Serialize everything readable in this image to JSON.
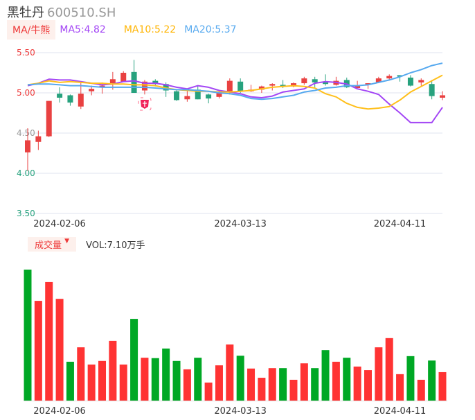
{
  "header": {
    "name": "黑牡丹",
    "code": "600510.SH"
  },
  "legend": {
    "indicator_button": "MA/牛熊",
    "ma5": "MA5:4.82",
    "ma10": "MA10:5.22",
    "ma20": "MA20:5.37"
  },
  "volume_legend": {
    "indicator_button": "成交量",
    "dropdown_icon": "▼",
    "vol": "VOL:7.10万手"
  },
  "colors": {
    "up": "#e94141",
    "down": "#27a27e",
    "vol_up": "#ff3333",
    "vol_down": "#00a825",
    "ma5": "#a346f5",
    "ma10": "#ffbf1a",
    "ma20": "#56a9ef",
    "grid": "#dfe3ef"
  },
  "chart_data": [
    {
      "type": "candlestick",
      "title": "黑牡丹 600510.SH",
      "ylim": [
        3.5,
        5.5
      ],
      "yticks": [
        {
          "label": "5.50",
          "v": 5.5,
          "color": "#ee3b3b"
        },
        {
          "label": "5.00",
          "v": 5.0,
          "color": "#ee3b3b"
        },
        {
          "label": "4.50",
          "v": 4.5,
          "color": "#999999"
        },
        {
          "label": "4.00",
          "v": 4.0,
          "color": "#27a27e"
        },
        {
          "label": "3.50",
          "v": 3.5,
          "color": "#27a27e"
        }
      ],
      "xticks": [
        {
          "label": "2024-02-06",
          "index": 3
        },
        {
          "label": "2024-03-13",
          "index": 20
        },
        {
          "label": "2024-04-11",
          "index": 35
        }
      ],
      "ohlc": [
        [
          4.26,
          4.41,
          4.56,
          4.03
        ],
        [
          4.39,
          4.46,
          4.53,
          4.29
        ],
        [
          4.46,
          4.9,
          4.9,
          4.45
        ],
        [
          4.99,
          4.94,
          5.07,
          4.88
        ],
        [
          4.97,
          4.88,
          4.98,
          4.84
        ],
        [
          4.83,
          4.99,
          5.14,
          4.8
        ],
        [
          5.02,
          5.05,
          5.09,
          4.97
        ],
        [
          5.07,
          5.09,
          5.13,
          4.99
        ],
        [
          5.12,
          5.17,
          5.26,
          5.04
        ],
        [
          5.14,
          5.25,
          5.27,
          5.14
        ],
        [
          5.26,
          5.0,
          5.41,
          5.0
        ],
        [
          5.03,
          5.14,
          5.16,
          4.98
        ],
        [
          5.15,
          5.11,
          5.17,
          5.08
        ],
        [
          5.11,
          5.03,
          5.13,
          4.95
        ],
        [
          5.02,
          4.91,
          5.03,
          4.9
        ],
        [
          4.92,
          4.96,
          5.04,
          4.89
        ],
        [
          5.04,
          4.92,
          5.09,
          4.92
        ],
        [
          4.98,
          4.93,
          4.99,
          4.87
        ],
        [
          4.95,
          5.01,
          5.03,
          4.93
        ],
        [
          5.02,
          5.15,
          5.18,
          4.98
        ],
        [
          5.14,
          5.02,
          5.18,
          5.0
        ],
        [
          5.02,
          5.04,
          5.1,
          5.01
        ],
        [
          5.04,
          5.08,
          5.09,
          5.0
        ],
        [
          5.09,
          5.11,
          5.12,
          5.03
        ],
        [
          5.1,
          5.08,
          5.16,
          5.06
        ],
        [
          5.08,
          5.12,
          5.13,
          5.07
        ],
        [
          5.12,
          5.18,
          5.2,
          5.1
        ],
        [
          5.17,
          5.13,
          5.2,
          5.07
        ],
        [
          5.13,
          5.11,
          5.23,
          5.09
        ],
        [
          5.1,
          5.15,
          5.2,
          5.09
        ],
        [
          5.16,
          5.07,
          5.19,
          5.06
        ],
        [
          5.06,
          5.09,
          5.15,
          5.06
        ],
        [
          5.1,
          5.12,
          5.12,
          5.05
        ],
        [
          5.13,
          5.18,
          5.2,
          5.12
        ],
        [
          5.18,
          5.21,
          5.23,
          5.16
        ],
        [
          5.22,
          5.21,
          5.22,
          5.14
        ],
        [
          5.19,
          5.09,
          5.22,
          5.08
        ],
        [
          5.13,
          5.16,
          5.18,
          5.09
        ],
        [
          5.11,
          4.96,
          5.16,
          4.92
        ],
        [
          4.94,
          4.97,
          5.02,
          4.91
        ]
      ],
      "series": [
        {
          "name": "MA5",
          "values": [
            5.09,
            5.12,
            5.17,
            5.16,
            5.16,
            5.14,
            5.12,
            5.1,
            5.11,
            5.14,
            5.15,
            5.12,
            5.12,
            5.1,
            5.07,
            5.05,
            5.09,
            5.07,
            5.03,
            5.01,
            4.99,
            4.95,
            4.94,
            4.96,
            5.01,
            5.03,
            5.05,
            5.12,
            5.14,
            5.13,
            5.11,
            5.05,
            5.02,
            4.98,
            4.86,
            4.75,
            4.63,
            4.63,
            4.63,
            4.82
          ]
        },
        {
          "name": "MA10",
          "values": [
            5.1,
            5.12,
            5.15,
            5.13,
            5.14,
            5.13,
            5.12,
            5.12,
            5.11,
            5.11,
            5.1,
            5.1,
            5.09,
            5.06,
            5.04,
            5.03,
            5.02,
            5.02,
            5.01,
            5.01,
            5.02,
            5.03,
            5.05,
            5.07,
            5.08,
            5.09,
            5.08,
            5.06,
            4.99,
            4.95,
            4.87,
            4.82,
            4.8,
            4.81,
            4.83,
            4.91,
            5.01,
            5.08,
            5.15,
            5.22
          ]
        },
        {
          "name": "MA20",
          "values": [
            5.1,
            5.11,
            5.11,
            5.1,
            5.09,
            5.09,
            5.08,
            5.07,
            5.07,
            5.07,
            5.07,
            5.07,
            5.06,
            5.05,
            5.04,
            5.04,
            5.03,
            5.02,
            5.0,
            4.99,
            4.97,
            4.93,
            4.92,
            4.93,
            4.95,
            4.97,
            5.01,
            5.03,
            5.06,
            5.07,
            5.09,
            5.09,
            5.1,
            5.13,
            5.16,
            5.2,
            5.25,
            5.29,
            5.34,
            5.37
          ]
        }
      ]
    },
    {
      "type": "bar",
      "title": "成交量",
      "ylabel": "万手",
      "xticks": [
        {
          "label": "2024-02-06",
          "index": 3
        },
        {
          "label": "2024-03-13",
          "index": 20
        },
        {
          "label": "2024-04-11",
          "index": 35
        }
      ],
      "values": [
        32.7,
        24.9,
        29.6,
        25.4,
        9.7,
        13.3,
        9.0,
        9.9,
        14.9,
        9.0,
        20.4,
        10.7,
        10.6,
        13.0,
        9.9,
        7.8,
        10.7,
        4.5,
        8.8,
        14.0,
        11.2,
        8.0,
        5.7,
        8.1,
        8.1,
        5.2,
        9.3,
        8.1,
        12.6,
        9.7,
        10.7,
        8.5,
        7.6,
        13.3,
        15.6,
        6.6,
        11.1,
        5.2,
        10.0,
        7.1
      ],
      "direction": [
        "down",
        "up",
        "up",
        "up",
        "down",
        "up",
        "up",
        "up",
        "up",
        "up",
        "down",
        "up",
        "down",
        "down",
        "down",
        "up",
        "down",
        "up",
        "up",
        "up",
        "down",
        "up",
        "up",
        "up",
        "down",
        "up",
        "up",
        "down",
        "down",
        "up",
        "down",
        "up",
        "up",
        "up",
        "up",
        "up",
        "down",
        "up",
        "down",
        "up"
      ]
    }
  ]
}
